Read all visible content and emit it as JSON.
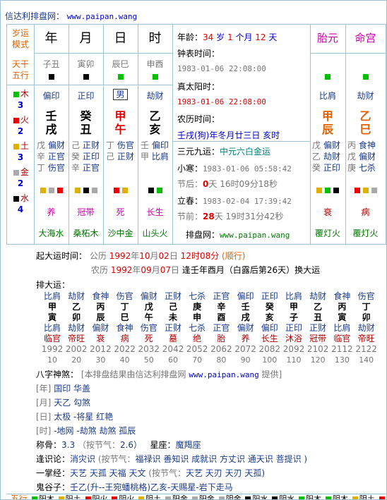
{
  "header": {
    "site": "信达利排盘网：",
    "url": "www.paipan.wang"
  },
  "left": {
    "yunmo": [
      "岁运",
      "模式"
    ],
    "tiangan": [
      "天干",
      "五行"
    ],
    "wuxing": [
      {
        "n": "木",
        "v": "3",
        "c": "#00c000"
      },
      {
        "n": "火",
        "v": "2",
        "c": "#ee0000"
      },
      {
        "n": "土",
        "v": "3",
        "c": "#e0b000"
      },
      {
        "n": "金",
        "v": "2",
        "c": "#aaaaaa"
      },
      {
        "n": "水",
        "v": "4",
        "c": "#000000"
      }
    ]
  },
  "cols": [
    "年",
    "月",
    "日",
    "时"
  ],
  "pillars": [
    {
      "hidden": "子丑",
      "stem": "壬",
      "branch": "戌",
      "god": "偏印",
      "sub": [
        "戊 偏财",
        "辛 正官",
        "丁 伤官"
      ],
      "sq": [
        "#e0b000",
        "#aaaaaa",
        "#ee0000"
      ],
      "cs": "养",
      "ny": "大海水",
      "kw": "■",
      "kwc": "#000000"
    },
    {
      "hidden": "寅卯",
      "stem": "癸",
      "branch": "丑",
      "god": "正印",
      "sub": [
        "己 正财",
        "癸 正印",
        "辛 正官"
      ],
      "sq": [
        "#e0b000",
        "#000000",
        "#aaaaaa"
      ],
      "cs": "冠带",
      "ny": "桑柘木",
      "kw": "■",
      "kwc": "#000000"
    },
    {
      "hidden": "辰巳",
      "stem": "甲",
      "branch": "午",
      "god": "男",
      "sub": [
        "丁 伤官",
        "己 正财",
        ""
      ],
      "sq": [
        "#ee0000",
        "#e0b000",
        ""
      ],
      "cs": "死",
      "ny": "沙中金",
      "kw": "■",
      "kwc": "#00c000"
    },
    {
      "hidden": "申酉",
      "stem": "乙",
      "branch": "亥",
      "god": "劫财",
      "sub": [
        "壬 偏印",
        "甲 比肩",
        ""
      ],
      "sq": [
        "#000000",
        "#00c000",
        ""
      ],
      "cs": "长生",
      "ny": "山头火",
      "kw": "■",
      "kwc": "#00c000"
    }
  ],
  "info": {
    "age_label": "年龄：",
    "age_y": "34",
    "age_yu": "岁",
    "age_m": "1",
    "age_mu": "个月",
    "age_d": "12",
    "age_du": "天",
    "clock_label": "钟表时间：",
    "clock": "1983-01-06 22:08:00",
    "solar_label": "真太阳时：",
    "solar": "1983-01-06 22:08:00",
    "lunar_label": "农历时间：",
    "lunar": "壬戌(狗)年冬月廿三日 亥时",
    "sanyuan_label": "三元九运：",
    "sanyuan": "中元六白金运",
    "xiaohan_label": "小寒：",
    "xiaohan": "1983-01-06 05:58:42",
    "jiehou_label": "节后：",
    "jiehou_d": "0",
    "jiehou_rest": "天 16时09分18秒",
    "lichun_label": "立春：",
    "lichun": "1983-02-04 17:39:42",
    "jieqian_label": "节前：",
    "jieqian_d": "28",
    "jieqian_rest": "天 19时31分42秒",
    "site_label": "排盘网：",
    "site": "www.paipan.wang"
  },
  "taiyuan": {
    "title": "胎元",
    "stem": "甲",
    "branch": "辰",
    "god": "比肩",
    "sub": [
      "戊 偏财",
      "乙 劫财",
      "癸 正印"
    ],
    "sq": [
      "#e0b000",
      "#00c000",
      "#000000"
    ],
    "cs": "衰",
    "ny": "覆灯火"
  },
  "minggong": {
    "title": "命宫",
    "stem": "乙",
    "branch": "巳",
    "god": "劫财",
    "sub": [
      "丙 食神",
      "戊 偏财",
      "庚 七杀"
    ],
    "sq": [
      "#ee0000",
      "#e0b000",
      "#aaaaaa"
    ],
    "cs": "病",
    "ny": "覆灯火"
  },
  "qiyun": {
    "label": "起大运时间：",
    "gongli": "公历",
    "gy": "1992",
    "gm": "10",
    "gd": "02",
    "gt": "12时08分",
    "shun": "(顺行)",
    "nongli": "农历",
    "ny": "1992",
    "nm": "09",
    "nd": "07",
    "feng": "逢壬年酉月（白露后第26天）换大运"
  },
  "dayun": {
    "label": "排大运：",
    "cols": [
      {
        "g": "比肩",
        "s": "甲",
        "b": "寅",
        "h": "比肩",
        "c": "临官",
        "y": "1992",
        "a": "10"
      },
      {
        "g": "劫财",
        "s": "乙",
        "b": "卯",
        "h": "劫财",
        "c": "帝旺",
        "y": "2002",
        "a": "20"
      },
      {
        "g": "食神",
        "s": "丙",
        "b": "辰",
        "h": "偏财",
        "c": "衰",
        "y": "2012",
        "a": "30"
      },
      {
        "g": "伤官",
        "s": "丁",
        "b": "巳",
        "h": "食神",
        "c": "病",
        "y": "2022",
        "a": "40"
      },
      {
        "g": "偏财",
        "s": "戊",
        "b": "午",
        "h": "伤官",
        "c": "死",
        "y": "2032",
        "a": "50"
      },
      {
        "g": "正财",
        "s": "己",
        "b": "未",
        "h": "正财",
        "c": "墓",
        "y": "2042",
        "a": "60"
      },
      {
        "g": "七杀",
        "s": "庚",
        "b": "申",
        "h": "七杀",
        "c": "绝",
        "y": "2052",
        "a": "70"
      },
      {
        "g": "正官",
        "s": "辛",
        "b": "酉",
        "h": "正官",
        "c": "胎",
        "y": "2062",
        "a": "80"
      },
      {
        "g": "偏印",
        "s": "壬",
        "b": "戌",
        "h": "偏财",
        "c": "养",
        "y": "2072",
        "a": "90"
      },
      {
        "g": "正印",
        "s": "癸",
        "b": "亥",
        "h": "偏印",
        "c": "长生",
        "y": "2082",
        "a": "100"
      },
      {
        "g": "比肩",
        "s": "甲",
        "b": "子",
        "h": "正印",
        "c": "沐浴",
        "y": "2092",
        "a": "110"
      },
      {
        "g": "劫财",
        "s": "乙",
        "b": "丑",
        "h": "正财",
        "c": "冠带",
        "y": "2102",
        "a": "120"
      },
      {
        "g": "食神",
        "s": "丙",
        "b": "寅",
        "h": "比肩",
        "c": "临官",
        "y": "2112",
        "a": "130"
      },
      {
        "g": "伤官",
        "s": "丁",
        "b": "卯",
        "h": "劫财",
        "c": "帝旺",
        "y": "2122",
        "a": "140"
      }
    ]
  },
  "shensha": {
    "label": "八字神煞：",
    "note": "[本排盘结果由信达利排盘网",
    "url": "www.paipan.wang",
    "tail": "提供]",
    "rows": [
      {
        "k": "[年]",
        "v": "国印 华盖"
      },
      {
        "k": "[月]",
        "v": "天乙 勾煞"
      },
      {
        "k": "[日]",
        "v": "太极 -将星 红艳"
      },
      {
        "k": "[时]",
        "v": "-地网 -劫煞 劫煞 孤辰"
      }
    ]
  },
  "chenggu": {
    "label": "称骨：",
    "v": "3.3",
    "jq": "（按节气：",
    "jv": "2.6）",
    "xz_label": "星座：",
    "xz": "魔羯座"
  },
  "fengu": {
    "label": "逢识论：",
    "v": "消灾识",
    "jq": "(按节气：",
    "jv": "福禄识 善知识 成就识 方丈识 通天识 菩提识 )"
  },
  "yizhang": {
    "label": "一掌经：",
    "v": "天艺 天孤 天福 天文",
    "jq": "(按节气：",
    "jv": "天艺 天刃 天刃 天孤)"
  },
  "guigu": {
    "label": "鬼谷子：",
    "v": "壬乙(升--王宛蟠桃格)乙亥-天赐星-岩下走马"
  },
  "bottom": {
    "label": "五行",
    "items": [
      "阳木",
      "阳土",
      "阳火",
      "阴火",
      "阴土",
      "阳金",
      "阳金",
      "阴金",
      "阳水",
      "阴水",
      "阳木",
      "阴木",
      "阴土",
      "阳火"
    ]
  }
}
